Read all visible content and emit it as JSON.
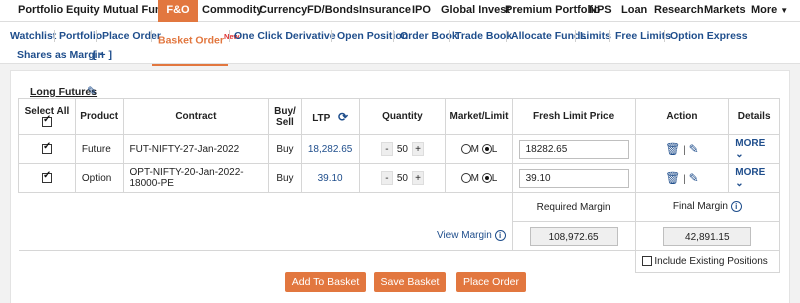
{
  "topnav": {
    "items": [
      "Portfolio",
      "Equity",
      "Mutual Funds",
      "F&O",
      "Commodity",
      "Currency",
      "FD/Bonds",
      "Insurance",
      "IPO",
      "Global Invest",
      "Premium Portfolio",
      "NPS",
      "Loan",
      "Research",
      "Markets",
      "More"
    ],
    "active": "F&O"
  },
  "subnav": {
    "items": [
      "Watchlist",
      "Portfolio",
      "Place Order",
      "Basket Order",
      "One Click Derivative",
      "Open Position",
      "Order Book",
      "Trade Book",
      "Allocate Funds",
      "Limits",
      "Free Limits",
      "Option Express",
      "Shares as Margin",
      "[ + ]"
    ],
    "new_badge": "New",
    "active": "Basket Order"
  },
  "basket": {
    "name": "Long Futures",
    "headers": {
      "select_all": "Select All",
      "product": "Product",
      "contract": "Contract",
      "buy_sell_1": "Buy/",
      "buy_sell_2": "Sell",
      "ltp": "LTP",
      "quantity": "Quantity",
      "market_limit": "Market/Limit",
      "fresh_limit_price": "Fresh Limit Price",
      "action": "Action",
      "details": "Details"
    },
    "rows": [
      {
        "product": "Future",
        "contract": "FUT-NIFTY-27-Jan-2022",
        "side": "Buy",
        "ltp": "18,282.65",
        "qty": "50",
        "m": "M",
        "l": "L",
        "price": "18282.65",
        "details": "MORE"
      },
      {
        "product": "Option",
        "contract": "OPT-NIFTY-20-Jan-2022-18000-PE",
        "side": "Buy",
        "ltp": "39.10",
        "qty": "50",
        "m": "M",
        "l": "L",
        "price": "39.10",
        "details": "MORE"
      }
    ],
    "margins": {
      "required_label": "Required Margin",
      "final_label": "Final Margin",
      "view_margin": "View Margin",
      "required_value": "108,972.65",
      "final_value": "42,891.15",
      "include_existing": "Include Existing Positions"
    }
  },
  "buttons": {
    "add": "Add To Basket",
    "save": "Save Basket",
    "place": "Place Order"
  },
  "colors": {
    "accent": "#e2773f",
    "link": "#1f4e8c"
  }
}
